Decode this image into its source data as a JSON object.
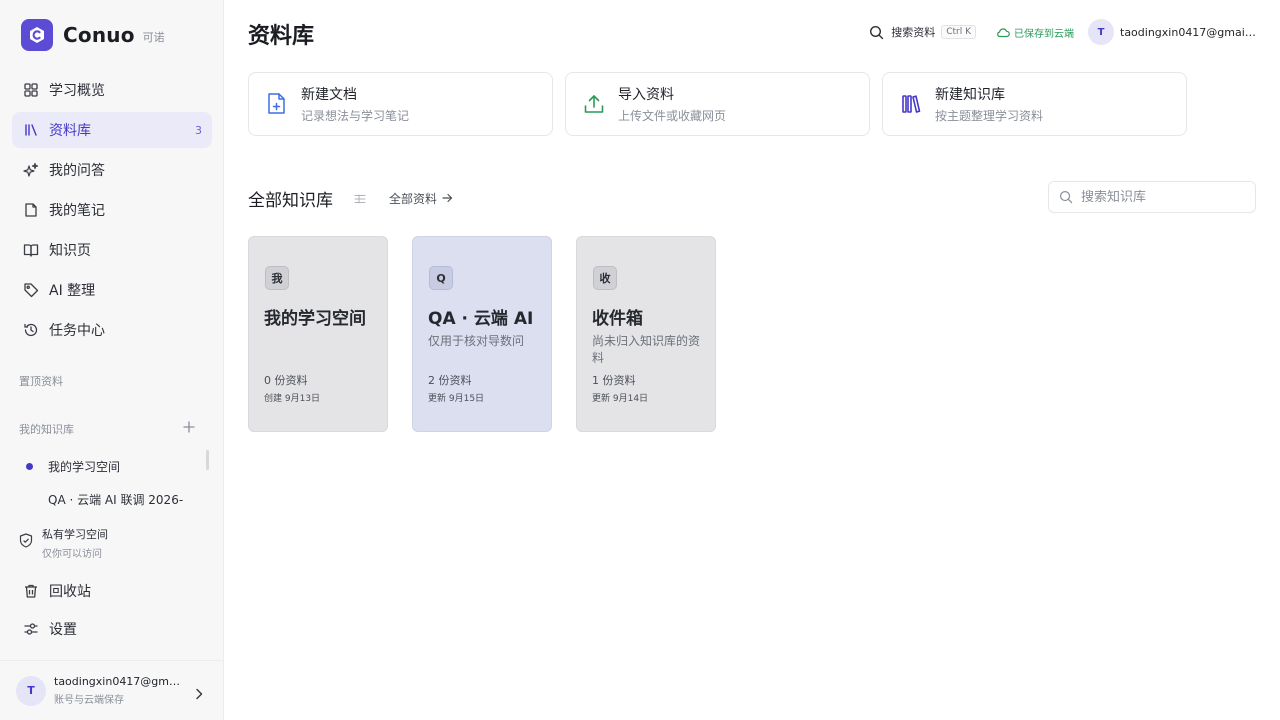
{
  "brand": {
    "name": "Conuo",
    "sub": "可诺"
  },
  "sidebar": {
    "nav": [
      {
        "label": "学习概览",
        "icon": "grid-icon"
      },
      {
        "label": "资料库",
        "icon": "library-icon",
        "count": "3",
        "active": true
      },
      {
        "label": "我的问答",
        "icon": "sparkle-icon"
      },
      {
        "label": "我的笔记",
        "icon": "note-icon"
      },
      {
        "label": "知识页",
        "icon": "book-icon"
      },
      {
        "label": "AI 整理",
        "icon": "tag-icon"
      },
      {
        "label": "任务中心",
        "icon": "history-icon"
      }
    ],
    "pinned_title": "置顶资料",
    "kb_title": "我的知识库",
    "kb_items": [
      {
        "label": "我的学习空间",
        "active": true
      },
      {
        "label": "QA · 云端 AI 联调 2026-"
      }
    ],
    "private": {
      "title": "私有学习空间",
      "subtitle": "仅你可以访问"
    },
    "bottom_nav": [
      {
        "label": "回收站",
        "icon": "trash-icon"
      },
      {
        "label": "设置",
        "icon": "settings-icon"
      }
    ],
    "user": {
      "initial": "T",
      "email": "taodingxin0417@gmai...",
      "subtitle": "账号与云端保存"
    }
  },
  "header": {
    "title": "资料库",
    "search_label": "搜索资料",
    "shortcut": "Ctrl K",
    "save_status": "已保存到云端",
    "user_initial": "T",
    "user_email": "taodingxin0417@gmail..."
  },
  "actions": [
    {
      "title": "新建文档",
      "subtitle": "记录想法与学习笔记",
      "icon": "new-doc-icon",
      "color": "#3d6fe0"
    },
    {
      "title": "导入资料",
      "subtitle": "上传文件或收藏网页",
      "icon": "upload-icon",
      "color": "#2a9a59"
    },
    {
      "title": "新建知识库",
      "subtitle": "按主题整理学习资料",
      "icon": "library-icon",
      "color": "#4538c6"
    }
  ],
  "kb_section": {
    "title": "全部知识库",
    "all_link": "全部资料",
    "search_placeholder": "搜索知识库"
  },
  "knowledge_bases": [
    {
      "badge": "我",
      "title": "我的学习空间",
      "desc": "",
      "count": "0 份资料",
      "date": "创建 9月13日",
      "tone": "gray"
    },
    {
      "badge": "Q",
      "title": "QA · 云端 AI",
      "desc": "仅用于核对导数问",
      "count": "2 份资料",
      "date": "更新 9月15日",
      "tone": "blue"
    },
    {
      "badge": "收",
      "title": "收件箱",
      "desc": "尚未归入知识库的资料",
      "count": "1 份资料",
      "date": "更新 9月14日",
      "tone": "gray"
    }
  ],
  "colors": {
    "accent": "#4538c6",
    "brand": "#5b4bd5",
    "success": "#2a9a59"
  }
}
